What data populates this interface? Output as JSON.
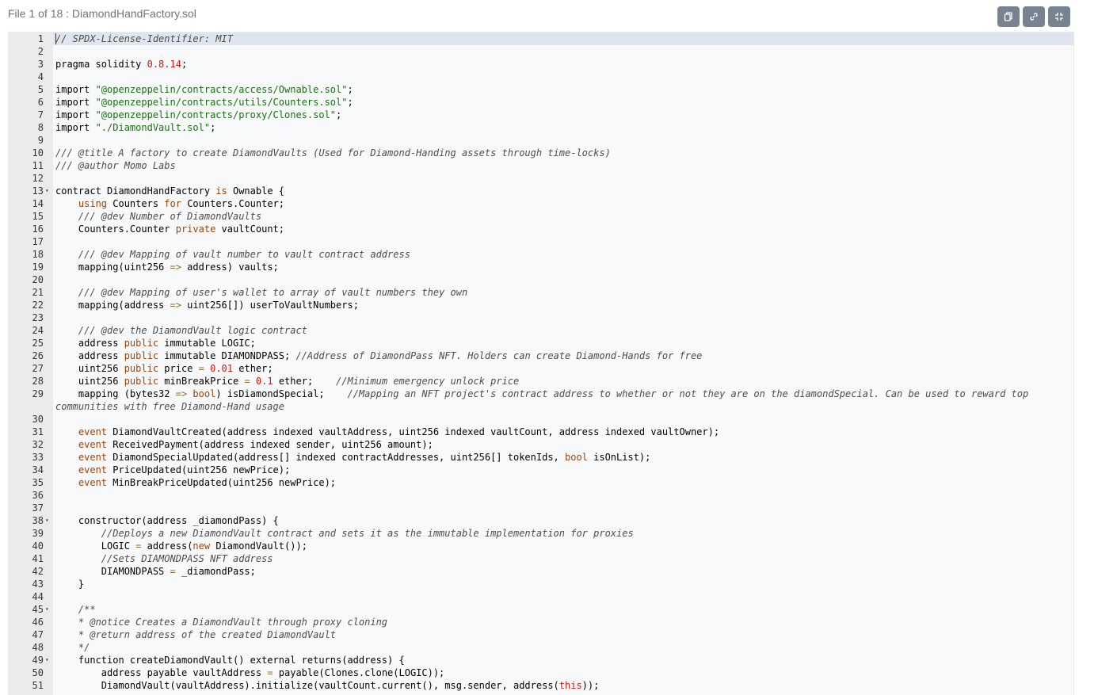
{
  "file_title": "File 1 of 18 : DiamondHandFactory.sol",
  "toolbar": [
    {
      "icon": "copy-icon"
    },
    {
      "icon": "link-icon"
    },
    {
      "icon": "collapse-icon"
    }
  ],
  "colors": {
    "comment": "#4c4c4c",
    "keyword": "#93460f",
    "string": "#1a6d12",
    "number": "#c41a16",
    "gutter": "#ebebeb",
    "active_line": "#dfe5ed"
  },
  "lines": [
    {
      "n": "1",
      "t": [
        [
          "cm",
          "// SPDX-License-Identifier: MIT"
        ]
      ]
    },
    {
      "n": "2",
      "t": []
    },
    {
      "n": "3",
      "t": [
        [
          "",
          "pragma solidity "
        ],
        [
          "num",
          "0.8.14"
        ],
        [
          "",
          ";"
        ]
      ]
    },
    {
      "n": "4",
      "t": []
    },
    {
      "n": "5",
      "t": [
        [
          "",
          "import "
        ],
        [
          "str",
          "\"@openzeppelin/contracts/access/Ownable.sol\""
        ],
        [
          "",
          ";"
        ]
      ]
    },
    {
      "n": "6",
      "t": [
        [
          "",
          "import "
        ],
        [
          "str",
          "\"@openzeppelin/contracts/utils/Counters.sol\""
        ],
        [
          "",
          ";"
        ]
      ]
    },
    {
      "n": "7",
      "t": [
        [
          "",
          "import "
        ],
        [
          "str",
          "\"@openzeppelin/contracts/proxy/Clones.sol\""
        ],
        [
          "",
          ";"
        ]
      ]
    },
    {
      "n": "8",
      "t": [
        [
          "",
          "import "
        ],
        [
          "str",
          "\"./DiamondVault.sol\""
        ],
        [
          "",
          ";"
        ]
      ]
    },
    {
      "n": "9",
      "t": []
    },
    {
      "n": "10",
      "t": [
        [
          "cm",
          "/// @title A factory to create DiamondVaults (Used for Diamond-Handing assets through time-locks)"
        ]
      ]
    },
    {
      "n": "11",
      "t": [
        [
          "cm",
          "/// @author Momo Labs"
        ]
      ]
    },
    {
      "n": "12",
      "t": []
    },
    {
      "n": "13",
      "fold": true,
      "t": [
        [
          "",
          "contract DiamondHandFactory "
        ],
        [
          "kw",
          "is"
        ],
        [
          "",
          " Ownable {"
        ]
      ]
    },
    {
      "n": "14",
      "t": [
        [
          "",
          "    "
        ],
        [
          "kw",
          "using"
        ],
        [
          "",
          " Counters "
        ],
        [
          "kw",
          "for"
        ],
        [
          "",
          " Counters.Counter;"
        ]
      ]
    },
    {
      "n": "15",
      "t": [
        [
          "",
          "    "
        ],
        [
          "cm",
          "/// @dev Number of DiamondVaults"
        ]
      ]
    },
    {
      "n": "16",
      "t": [
        [
          "",
          "    Counters.Counter "
        ],
        [
          "kw",
          "private"
        ],
        [
          "",
          " vaultCount;"
        ]
      ]
    },
    {
      "n": "17",
      "t": []
    },
    {
      "n": "18",
      "t": [
        [
          "",
          "    "
        ],
        [
          "cm",
          "/// @dev Mapping of vault number to vault contract address"
        ]
      ]
    },
    {
      "n": "19",
      "t": [
        [
          "",
          "    mapping(uint256 "
        ],
        [
          "op",
          "=>"
        ],
        [
          "",
          " address) vaults;"
        ]
      ]
    },
    {
      "n": "20",
      "t": []
    },
    {
      "n": "21",
      "t": [
        [
          "",
          "    "
        ],
        [
          "cm",
          "/// @dev Mapping of user's wallet to array of vault numbers they own"
        ]
      ]
    },
    {
      "n": "22",
      "t": [
        [
          "",
          "    mapping(address "
        ],
        [
          "op",
          "=>"
        ],
        [
          "",
          " uint256[]) userToVaultNumbers;"
        ]
      ]
    },
    {
      "n": "23",
      "t": []
    },
    {
      "n": "24",
      "t": [
        [
          "",
          "    "
        ],
        [
          "cm",
          "/// @dev the DiamondVault logic contract"
        ]
      ]
    },
    {
      "n": "25",
      "t": [
        [
          "",
          "    address "
        ],
        [
          "kw",
          "public"
        ],
        [
          "",
          " immutable LOGIC;"
        ]
      ]
    },
    {
      "n": "26",
      "t": [
        [
          "",
          "    address "
        ],
        [
          "kw",
          "public"
        ],
        [
          "",
          " immutable DIAMONDPASS; "
        ],
        [
          "cm",
          "//Address of DiamondPass NFT. Holders can create Diamond-Hands for free"
        ]
      ]
    },
    {
      "n": "27",
      "t": [
        [
          "",
          "    uint256 "
        ],
        [
          "kw",
          "public"
        ],
        [
          "",
          " price "
        ],
        [
          "op",
          "="
        ],
        [
          "",
          " "
        ],
        [
          "num",
          "0.01"
        ],
        [
          "",
          " ether;"
        ]
      ]
    },
    {
      "n": "28",
      "t": [
        [
          "",
          "    uint256 "
        ],
        [
          "kw",
          "public"
        ],
        [
          "",
          " minBreakPrice "
        ],
        [
          "op",
          "="
        ],
        [
          "",
          " "
        ],
        [
          "num",
          "0.1"
        ],
        [
          "",
          " ether;    "
        ],
        [
          "cm",
          "//Minimum emergency unlock price"
        ]
      ]
    },
    {
      "n": "29",
      "wrap": true,
      "t": [
        [
          "",
          "    mapping (bytes32 "
        ],
        [
          "op",
          "=>"
        ],
        [
          "",
          " "
        ],
        [
          "kw",
          "bool"
        ],
        [
          "",
          ") isDiamondSpecial;    "
        ],
        [
          "cm",
          "//Mapping an NFT project's contract address to whether or not they are on the diamondSpecial. Can be used to reward top"
        ]
      ],
      "cont": [
        [
          "cm",
          "communities with free Diamond-Hand usage"
        ]
      ]
    },
    {
      "n": "30",
      "t": []
    },
    {
      "n": "31",
      "t": [
        [
          "",
          "    "
        ],
        [
          "kw",
          "event"
        ],
        [
          "",
          " DiamondVaultCreated(address indexed vaultAddress, uint256 indexed vaultCount, address indexed vaultOwner);"
        ]
      ]
    },
    {
      "n": "32",
      "t": [
        [
          "",
          "    "
        ],
        [
          "kw",
          "event"
        ],
        [
          "",
          " ReceivedPayment(address indexed sender, uint256 amount);"
        ]
      ]
    },
    {
      "n": "33",
      "t": [
        [
          "",
          "    "
        ],
        [
          "kw",
          "event"
        ],
        [
          "",
          " DiamondSpecialUpdated(address[] indexed contractAddresses, uint256[] tokenIds, "
        ],
        [
          "kw",
          "bool"
        ],
        [
          "",
          " isOnList);"
        ]
      ]
    },
    {
      "n": "34",
      "t": [
        [
          "",
          "    "
        ],
        [
          "kw",
          "event"
        ],
        [
          "",
          " PriceUpdated(uint256 newPrice);"
        ]
      ]
    },
    {
      "n": "35",
      "t": [
        [
          "",
          "    "
        ],
        [
          "kw",
          "event"
        ],
        [
          "",
          " MinBreakPriceUpdated(uint256 newPrice);"
        ]
      ]
    },
    {
      "n": "36",
      "t": []
    },
    {
      "n": "37",
      "t": []
    },
    {
      "n": "38",
      "fold": true,
      "t": [
        [
          "",
          "    constructor(address _diamondPass) {"
        ]
      ]
    },
    {
      "n": "39",
      "t": [
        [
          "",
          "        "
        ],
        [
          "cm",
          "//Deploys a new DiamondVault contract and sets it as the immutable implementation for proxies"
        ]
      ]
    },
    {
      "n": "40",
      "t": [
        [
          "",
          "        LOGIC "
        ],
        [
          "op",
          "="
        ],
        [
          "",
          " address("
        ],
        [
          "kw",
          "new"
        ],
        [
          "",
          " DiamondVault());"
        ]
      ]
    },
    {
      "n": "41",
      "t": [
        [
          "",
          "        "
        ],
        [
          "cm",
          "//Sets DIAMONDPASS NFT address"
        ]
      ]
    },
    {
      "n": "42",
      "t": [
        [
          "",
          "        DIAMONDPASS "
        ],
        [
          "op",
          "="
        ],
        [
          "",
          " _diamondPass;"
        ]
      ]
    },
    {
      "n": "43",
      "t": [
        [
          "",
          "    }"
        ]
      ]
    },
    {
      "n": "44",
      "t": []
    },
    {
      "n": "45",
      "fold": true,
      "t": [
        [
          "",
          "    "
        ],
        [
          "cm",
          "/**"
        ]
      ]
    },
    {
      "n": "46",
      "t": [
        [
          "",
          "    "
        ],
        [
          "cm",
          "* @notice Creates a DiamondVault through proxy cloning"
        ]
      ]
    },
    {
      "n": "47",
      "t": [
        [
          "",
          "    "
        ],
        [
          "cm",
          "* @return address of the created DiamondVault"
        ]
      ]
    },
    {
      "n": "48",
      "t": [
        [
          "",
          "    "
        ],
        [
          "cm",
          "*/"
        ]
      ]
    },
    {
      "n": "49",
      "fold": true,
      "t": [
        [
          "",
          "    function createDiamondVault() external returns(address) {"
        ]
      ]
    },
    {
      "n": "50",
      "t": [
        [
          "",
          "        address payable vaultAddress "
        ],
        [
          "op",
          "="
        ],
        [
          "",
          " payable(Clones.clone(LOGIC));"
        ]
      ]
    },
    {
      "n": "51",
      "t": [
        [
          "",
          "        DiamondVault(vaultAddress).initialize(vaultCount.current(), msg.sender, address("
        ],
        [
          "num",
          "this"
        ],
        [
          "",
          "));"
        ]
      ]
    }
  ]
}
